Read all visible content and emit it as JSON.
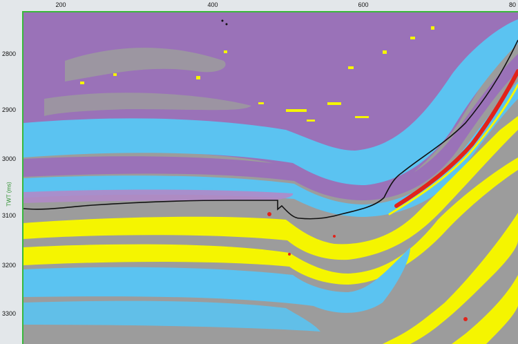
{
  "axes": {
    "x_ticks": [
      "200",
      "400",
      "600",
      "80"
    ],
    "y_ticks": [
      "2800",
      "2900",
      "3000",
      "3100",
      "3200",
      "3300"
    ],
    "y_title": "TWT (ms)"
  },
  "colors": {
    "violet": "#9a72b8",
    "light_violet": "#b08ac8",
    "cyan": "#5bc3f1",
    "grey": "#9c9c9c",
    "yellow": "#f5f500",
    "red": "#e2231a",
    "horizon": "#111111",
    "ruler_line": "#37b83a"
  }
}
